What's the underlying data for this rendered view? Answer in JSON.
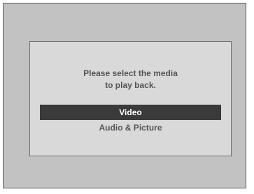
{
  "dialog": {
    "prompt_line1": "Please select the media",
    "prompt_line2": "to play back."
  },
  "options": [
    {
      "label": "Video",
      "selected": true
    },
    {
      "label": "Audio & Picture",
      "selected": false
    }
  ],
  "colors": {
    "background": "#c2c2c2",
    "dialog": "#d9d9d9",
    "highlight": "#3a3a3a",
    "text": "#555555"
  }
}
